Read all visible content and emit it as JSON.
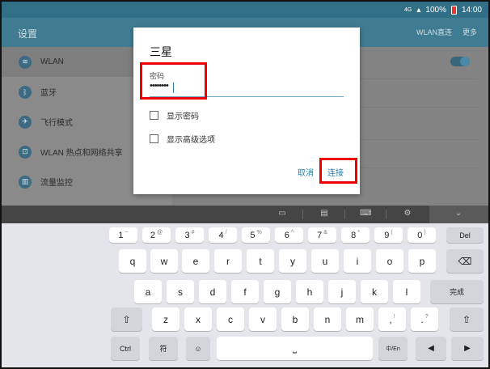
{
  "status_bar": {
    "signal": "4G",
    "battery": "100%",
    "time": "14:00"
  },
  "settings_app": {
    "title": "设置",
    "actions": [
      "WLAN直连",
      "更多"
    ],
    "sidebar": [
      {
        "label": "WLAN",
        "icon": "wifi-icon",
        "glyph": "≋"
      },
      {
        "label": "蓝牙",
        "icon": "bluetooth-icon",
        "glyph": "ᛒ"
      },
      {
        "label": "飞行模式",
        "icon": "airplane-icon",
        "glyph": "✈"
      },
      {
        "label": "WLAN 热点和网络共享",
        "icon": "hotspot-icon",
        "glyph": "⊡"
      },
      {
        "label": "流量监控",
        "icon": "data-usage-icon",
        "glyph": "▥"
      }
    ]
  },
  "dialog": {
    "title": "三星",
    "password_label": "密码",
    "password_value": "••••••••",
    "show_password": "显示密码",
    "advanced_options": "显示高级选项",
    "cancel": "取消",
    "connect": "连接"
  },
  "keyboard": {
    "num_row": [
      {
        "k": "1",
        "s": "~"
      },
      {
        "k": "2",
        "s": "@"
      },
      {
        "k": "3",
        "s": "#"
      },
      {
        "k": "4",
        "s": "/"
      },
      {
        "k": "5",
        "s": "%"
      },
      {
        "k": "6",
        "s": "^"
      },
      {
        "k": "7",
        "s": "&"
      },
      {
        "k": "8",
        "s": "*"
      },
      {
        "k": "9",
        "s": "("
      },
      {
        "k": "0",
        "s": ")"
      }
    ],
    "row1": [
      "q",
      "w",
      "e",
      "r",
      "t",
      "y",
      "u",
      "i",
      "o",
      "p"
    ],
    "row2": [
      "a",
      "s",
      "d",
      "f",
      "g",
      "h",
      "j",
      "k",
      "l"
    ],
    "row3": [
      "z",
      "x",
      "c",
      "v",
      "b",
      "n",
      "m"
    ],
    "del": "Del",
    "done": "完成",
    "ctrl": "Ctrl",
    "symbols": "符",
    "comma_sub": "!",
    "period_sub": "?",
    "lang": "中/En",
    "comma": ",",
    "period": "."
  }
}
